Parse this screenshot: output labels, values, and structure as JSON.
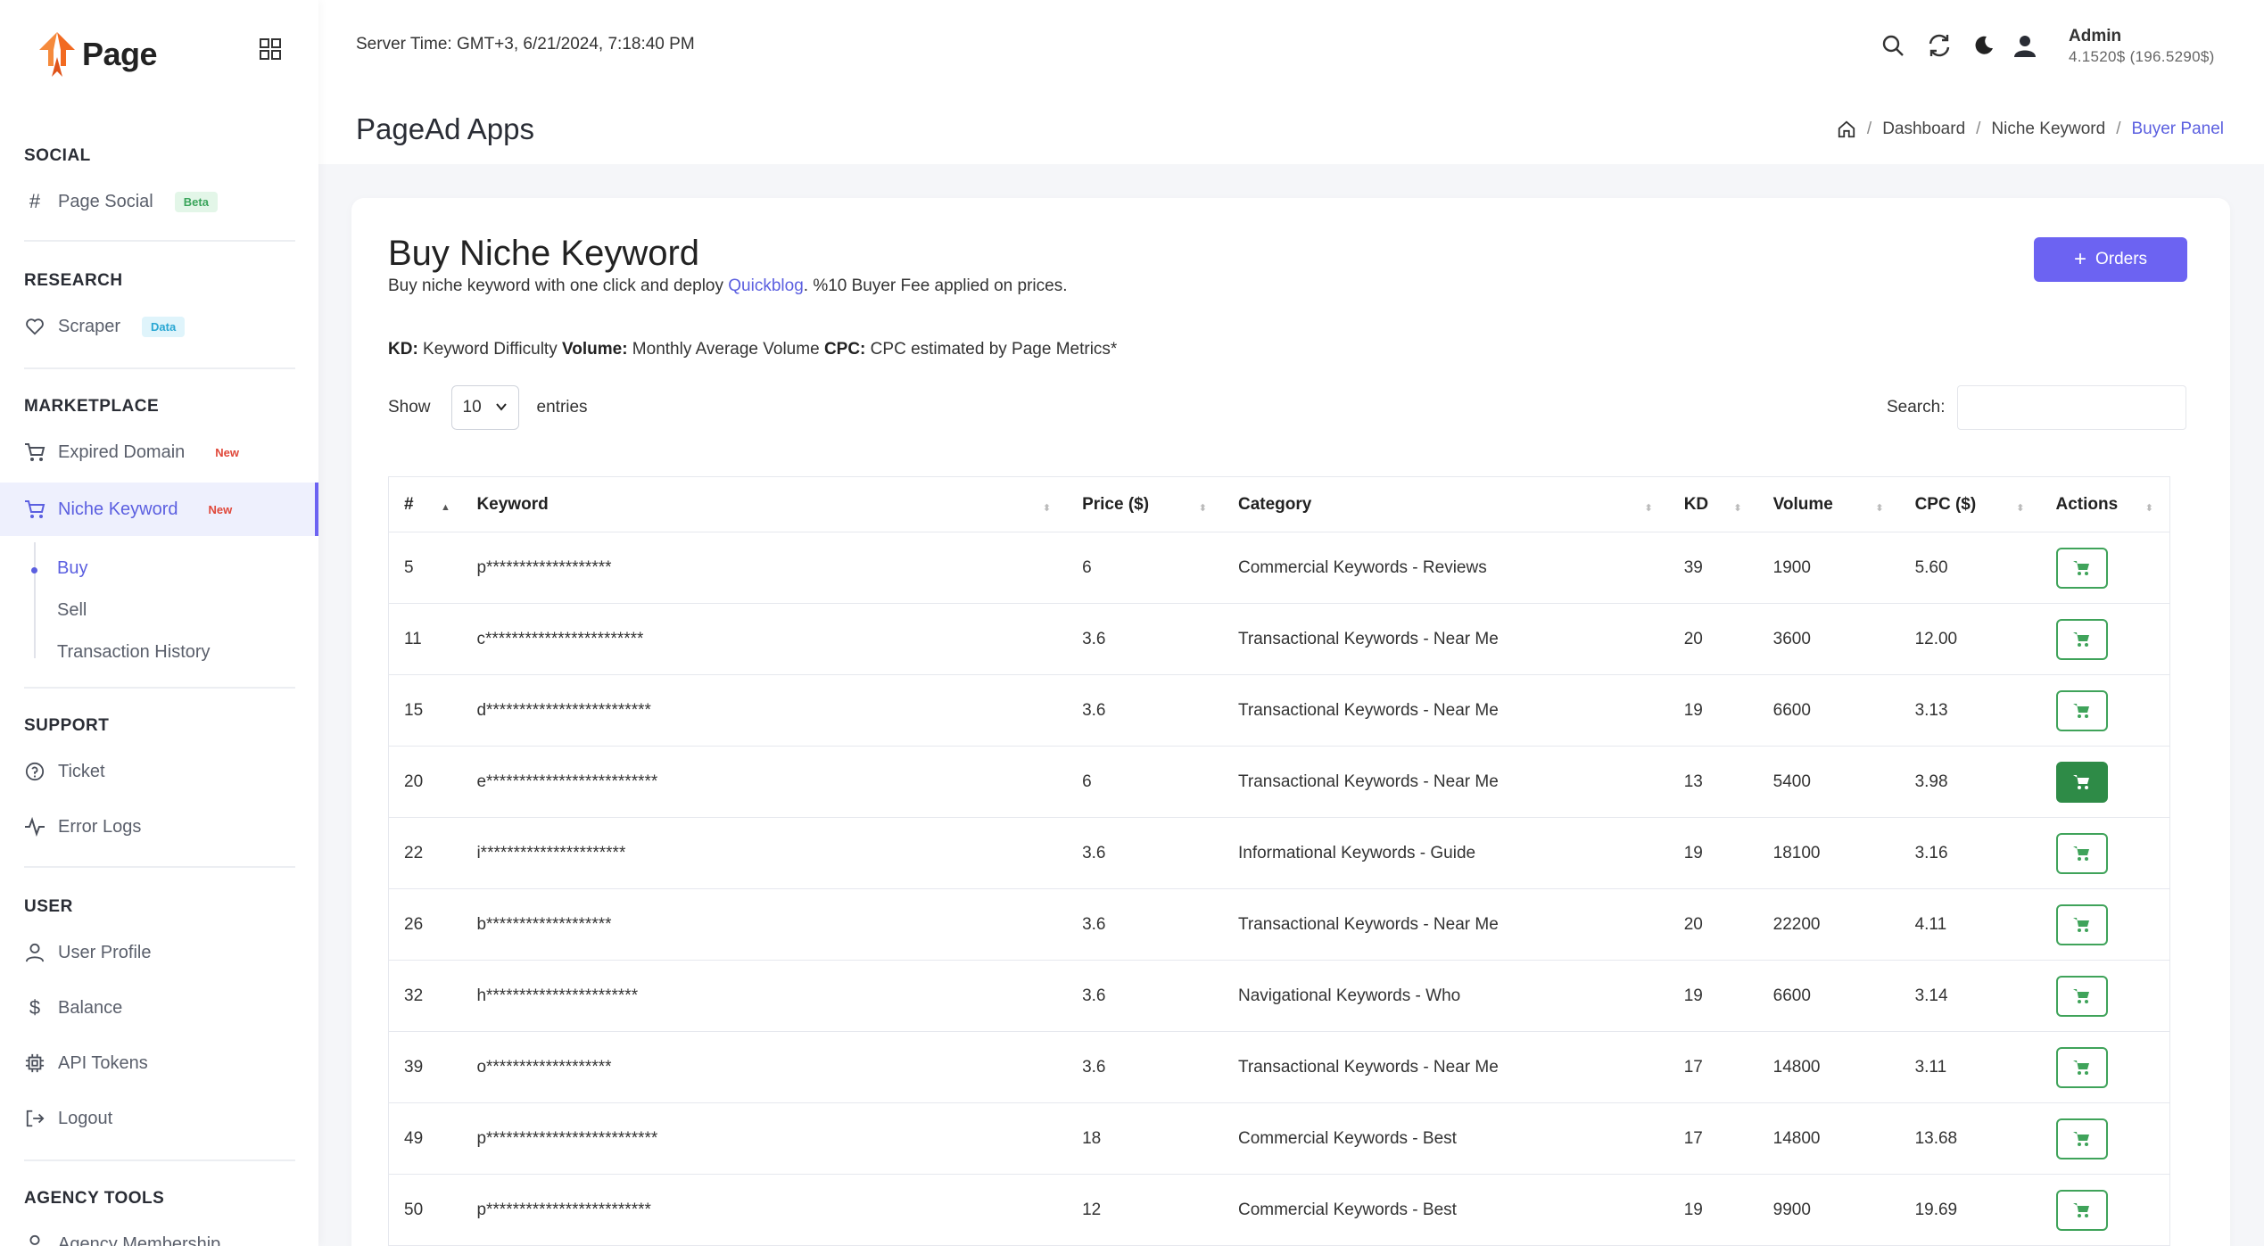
{
  "brand": {
    "name": "Page"
  },
  "header": {
    "server_time": "Server Time: GMT+3, 6/21/2024, 7:18:40 PM",
    "admin_name": "Admin",
    "admin_balance": "4.1520$ (196.5290$)"
  },
  "page": {
    "title": "PageAd Apps"
  },
  "breadcrumb": {
    "dashboard": "Dashboard",
    "niche": "Niche Keyword",
    "current": "Buyer Panel",
    "sep": "/"
  },
  "sidebar": {
    "social": {
      "title": "SOCIAL",
      "page_social": "Page Social",
      "page_social_badge": "Beta"
    },
    "research": {
      "title": "RESEARCH",
      "scraper": "Scraper",
      "scraper_badge": "Data"
    },
    "marketplace": {
      "title": "MARKETPLACE",
      "expired": "Expired Domain",
      "expired_badge": "New",
      "niche": "Niche Keyword",
      "niche_badge": "New",
      "buy": "Buy",
      "sell": "Sell",
      "history": "Transaction History"
    },
    "support": {
      "title": "SUPPORT",
      "ticket": "Ticket",
      "errors": "Error Logs"
    },
    "user": {
      "title": "USER",
      "profile": "User Profile",
      "balance": "Balance",
      "tokens": "API Tokens",
      "logout": "Logout"
    },
    "agency": {
      "title": "AGENCY TOOLS",
      "membership": "Agency Membership"
    }
  },
  "card": {
    "title": "Buy Niche Keyword",
    "desc_before": "Buy niche keyword with one click and deploy ",
    "desc_link": "Quickblog",
    "desc_after": ". %10 Buyer Fee applied on prices.",
    "orders_label": "Orders",
    "legend": {
      "kd_label": "KD:",
      "kd_text": " Keyword Difficulty ",
      "vol_label": "Volume:",
      "vol_text": " Monthly Average Volume ",
      "cpc_label": "CPC:",
      "cpc_text": " CPC estimated by Page Metrics*"
    },
    "show_label": "Show",
    "entries_value": "10",
    "entries_label": "entries",
    "search_label": "Search:"
  },
  "table": {
    "headers": [
      "#",
      "Keyword",
      "Price ($)",
      "Category",
      "KD",
      "Volume",
      "CPC ($)",
      "Actions"
    ],
    "rows": [
      {
        "id": "5",
        "keyword": "p*******************",
        "price": "6",
        "category": "Commercial Keywords - Reviews",
        "kd": "39",
        "volume": "1900",
        "cpc": "5.60"
      },
      {
        "id": "11",
        "keyword": "c************************",
        "price": "3.6",
        "category": "Transactional Keywords - Near Me",
        "kd": "20",
        "volume": "3600",
        "cpc": "12.00"
      },
      {
        "id": "15",
        "keyword": "d*************************",
        "price": "3.6",
        "category": "Transactional Keywords - Near Me",
        "kd": "19",
        "volume": "6600",
        "cpc": "3.13"
      },
      {
        "id": "20",
        "keyword": "e**************************",
        "price": "6",
        "category": "Transactional Keywords - Near Me",
        "kd": "13",
        "volume": "5400",
        "cpc": "3.98"
      },
      {
        "id": "22",
        "keyword": "i**********************",
        "price": "3.6",
        "category": "Informational Keywords - Guide",
        "kd": "19",
        "volume": "18100",
        "cpc": "3.16"
      },
      {
        "id": "26",
        "keyword": "b*******************",
        "price": "3.6",
        "category": "Transactional Keywords - Near Me",
        "kd": "20",
        "volume": "22200",
        "cpc": "4.11"
      },
      {
        "id": "32",
        "keyword": "h***********************",
        "price": "3.6",
        "category": "Navigational Keywords - Who",
        "kd": "19",
        "volume": "6600",
        "cpc": "3.14"
      },
      {
        "id": "39",
        "keyword": "o*******************",
        "price": "3.6",
        "category": "Transactional Keywords - Near Me",
        "kd": "17",
        "volume": "14800",
        "cpc": "3.11"
      },
      {
        "id": "49",
        "keyword": "p**************************",
        "price": "18",
        "category": "Commercial Keywords - Best",
        "kd": "17",
        "volume": "14800",
        "cpc": "13.68"
      },
      {
        "id": "50",
        "keyword": "p*************************",
        "price": "12",
        "category": "Commercial Keywords - Best",
        "kd": "19",
        "volume": "9900",
        "cpc": "19.69"
      }
    ]
  },
  "colors": {
    "accent": "#6c63f2",
    "cart_green": "#3fa35a",
    "cart_filled": "#2e8b47",
    "logo_orange": "#f26a21"
  },
  "icons": {
    "grid": "grid-icon",
    "search": "search-icon",
    "refresh": "refresh-icon",
    "moon": "moon-icon",
    "user": "user-icon",
    "cart": "cart-icon",
    "home": "home-icon"
  }
}
